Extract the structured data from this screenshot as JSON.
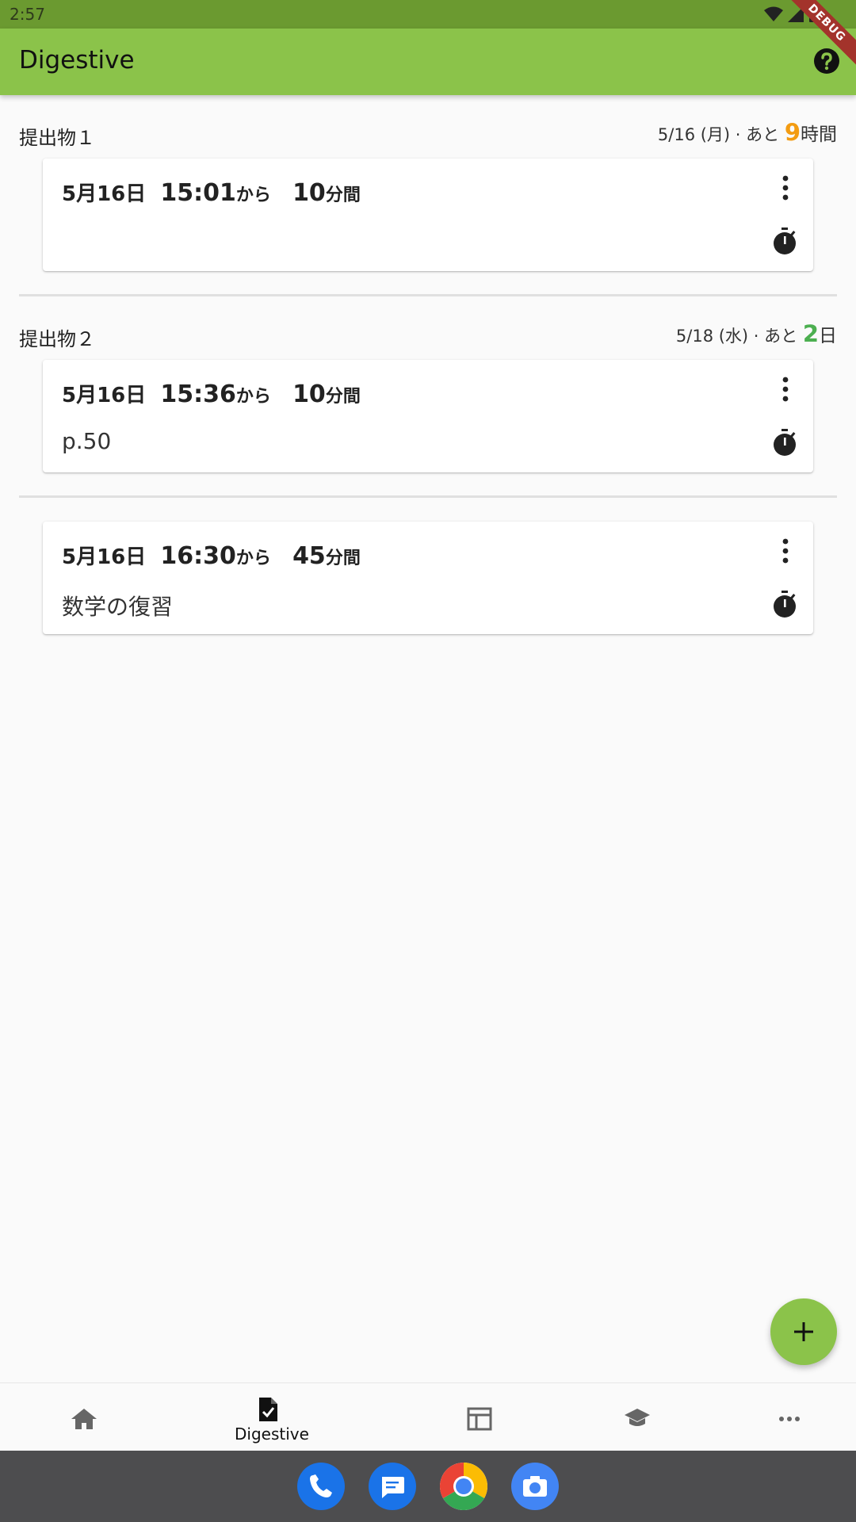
{
  "status_bar": {
    "time": "2:57"
  },
  "debug_banner": "DEBUG",
  "app_bar": {
    "title": "Digestive"
  },
  "groups": [
    {
      "title": "提出物１",
      "due_date": "5/16 (月) · あと ",
      "remaining_value": "9",
      "remaining_unit": "時間",
      "remaining_color": "#f39c12",
      "tasks": [
        {
          "date": "5月16日",
          "start": "15:01",
          "from": "から",
          "duration": "10",
          "duration_unit": "分間",
          "note": ""
        }
      ]
    },
    {
      "title": "提出物２",
      "due_date": "5/18 (水) · あと ",
      "remaining_value": "2",
      "remaining_unit": "日",
      "remaining_color": "#4caf50",
      "tasks": [
        {
          "date": "5月16日",
          "start": "15:36",
          "from": "から",
          "duration": "10",
          "duration_unit": "分間",
          "note": "p.50"
        }
      ]
    },
    {
      "title": "",
      "tasks": [
        {
          "date": "5月16日",
          "start": "16:30",
          "from": "から",
          "duration": "45",
          "duration_unit": "分間",
          "note": "数学の復習"
        }
      ]
    }
  ],
  "bottom_nav": {
    "items": [
      {
        "icon": "home-icon",
        "label": ""
      },
      {
        "icon": "assignment-check-icon",
        "label": "Digestive",
        "active": true
      },
      {
        "icon": "timetable-icon",
        "label": ""
      },
      {
        "icon": "school-icon",
        "label": ""
      },
      {
        "icon": "more-horiz-icon",
        "label": ""
      }
    ]
  },
  "dock": [
    "phone-icon",
    "messages-icon",
    "chrome-icon",
    "camera-icon"
  ],
  "colors": {
    "app_bar": "#8bc34a",
    "status_bar": "#6b9a30",
    "accent_orange": "#f39c12",
    "accent_green": "#4caf50"
  }
}
